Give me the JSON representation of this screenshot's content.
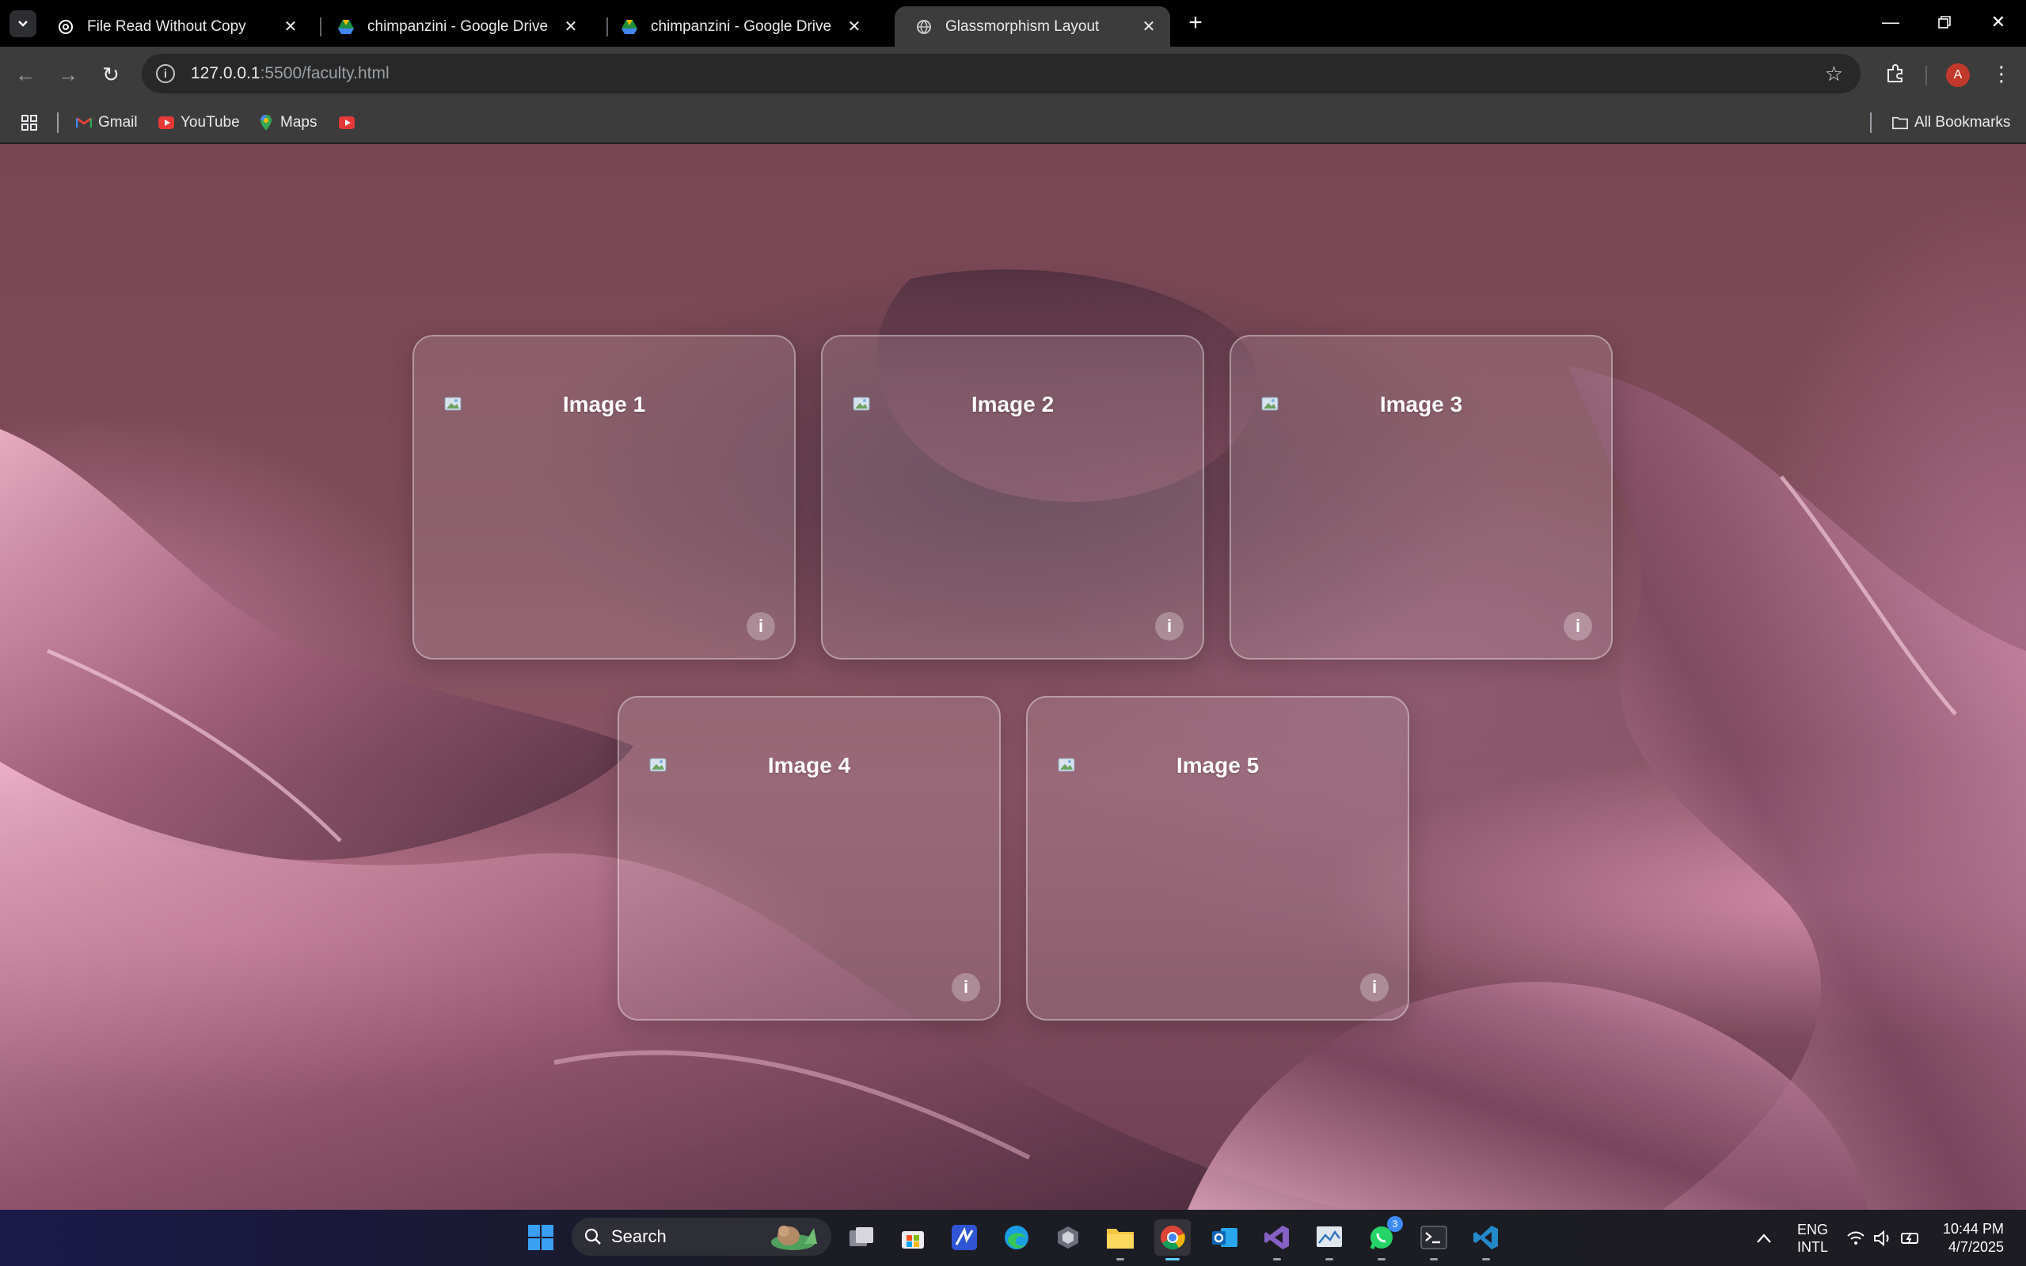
{
  "browser": {
    "tabs": [
      {
        "title": "File Read Without Copy",
        "favicon": "chatgpt-icon",
        "active": false
      },
      {
        "title": "chimpanzini - Google Drive",
        "favicon": "google-drive-icon",
        "active": false
      },
      {
        "title": "chimpanzini - Google Drive",
        "favicon": "google-drive-icon",
        "active": false
      },
      {
        "title": "Glassmorphism Layout",
        "favicon": "globe-icon",
        "active": true
      }
    ],
    "address_host": "127.0.0.1",
    "address_path": ":5500/faculty.html",
    "profile_initial": "A",
    "bookmarks": [
      {
        "label": "Gmail",
        "icon": "gmail-icon"
      },
      {
        "label": "YouTube",
        "icon": "youtube-icon"
      },
      {
        "label": "Maps",
        "icon": "maps-icon"
      },
      {
        "label": "",
        "icon": "youtube-icon"
      }
    ],
    "all_bookmarks_label": "All Bookmarks"
  },
  "page": {
    "cards": [
      {
        "label": "Image 1",
        "info": "i"
      },
      {
        "label": "Image 2",
        "info": "i"
      },
      {
        "label": "Image 3",
        "info": "i"
      },
      {
        "label": "Image 4",
        "info": "i"
      },
      {
        "label": "Image 5",
        "info": "i"
      }
    ]
  },
  "taskbar": {
    "search_label": "Search",
    "apps": [
      "start-icon",
      "task-view-icon",
      "store-icon",
      "app-icon",
      "edge-icon",
      "app-icon",
      "file-explorer-icon",
      "chrome-icon",
      "outlook-icon",
      "visual-studio-icon",
      "app-icon",
      "whatsapp-icon",
      "terminal-icon",
      "vscode-icon"
    ],
    "whatsapp_badge": "3",
    "language_line1": "ENG",
    "language_line2": "INTL",
    "time": "10:44 PM",
    "date": "4/7/2025"
  }
}
